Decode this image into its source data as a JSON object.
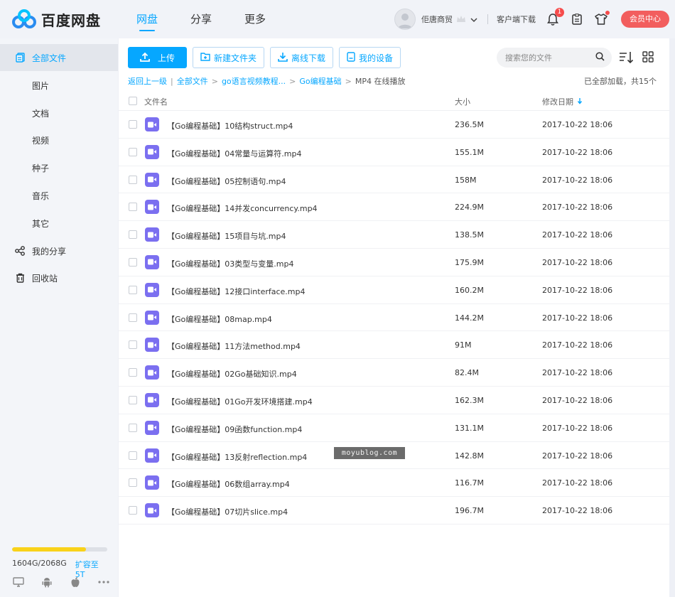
{
  "brand": {
    "name": "百度网盘"
  },
  "nav": [
    {
      "label": "网盘",
      "active": true
    },
    {
      "label": "分享",
      "active": false
    },
    {
      "label": "更多",
      "active": false
    }
  ],
  "user": {
    "name": "佢唐商贸"
  },
  "header": {
    "client_download": "客户端下载",
    "notification_count": "1",
    "vip_button": "会员中心",
    "colors": {
      "accent": "#06a7ff",
      "vip": "#f25e5e"
    },
    "icons": [
      "bell-icon",
      "clipboard-icon",
      "tshirt-icon"
    ]
  },
  "sidebar": {
    "items": [
      {
        "label": "全部文件",
        "icon": "files-icon",
        "active": true
      },
      {
        "label": "图片"
      },
      {
        "label": "文档"
      },
      {
        "label": "视频"
      },
      {
        "label": "种子"
      },
      {
        "label": "音乐"
      },
      {
        "label": "其它"
      },
      {
        "label": "我的分享",
        "icon": "share-icon"
      },
      {
        "label": "回收站",
        "icon": "trash-icon"
      }
    ],
    "quota": {
      "used": "1604G/2068G",
      "used_fraction": 0.776,
      "expand_label": "扩容至5T"
    },
    "platforms": [
      "desktop-icon",
      "android-icon",
      "apple-icon",
      "more-icon"
    ]
  },
  "toolbar": {
    "upload": "上传",
    "new_folder": "新建文件夹",
    "offline_download": "离线下载",
    "my_devices": "我的设备"
  },
  "search": {
    "placeholder": "搜索您的文件"
  },
  "breadcrumb": {
    "back": "返回上一级",
    "items": [
      "全部文件",
      "go语言视频教程...",
      "Go编程基础"
    ],
    "current": "MP4 在线播放"
  },
  "status": {
    "loaded": "已全部加载，共15个"
  },
  "table": {
    "headers": {
      "name": "文件名",
      "size": "大小",
      "date": "修改日期"
    },
    "rows": [
      {
        "name": "【Go编程基础】10结构struct.mp4",
        "size": "236.5M",
        "date": "2017-10-22 18:06"
      },
      {
        "name": "【Go编程基础】04常量与运算符.mp4",
        "size": "155.1M",
        "date": "2017-10-22 18:06"
      },
      {
        "name": "【Go编程基础】05控制语句.mp4",
        "size": "158M",
        "date": "2017-10-22 18:06"
      },
      {
        "name": "【Go编程基础】14并发concurrency.mp4",
        "size": "224.9M",
        "date": "2017-10-22 18:06"
      },
      {
        "name": "【Go编程基础】15项目与坑.mp4",
        "size": "138.5M",
        "date": "2017-10-22 18:06"
      },
      {
        "name": "【Go编程基础】03类型与变量.mp4",
        "size": "175.9M",
        "date": "2017-10-22 18:06"
      },
      {
        "name": "【Go编程基础】12接口interface.mp4",
        "size": "160.2M",
        "date": "2017-10-22 18:06"
      },
      {
        "name": "【Go编程基础】08map.mp4",
        "size": "144.2M",
        "date": "2017-10-22 18:06"
      },
      {
        "name": "【Go编程基础】11方法method.mp4",
        "size": "91M",
        "date": "2017-10-22 18:06"
      },
      {
        "name": "【Go编程基础】02Go基础知识.mp4",
        "size": "82.4M",
        "date": "2017-10-22 18:06"
      },
      {
        "name": "【Go编程基础】01Go开发环境搭建.mp4",
        "size": "162.3M",
        "date": "2017-10-22 18:06"
      },
      {
        "name": "【Go编程基础】09函数function.mp4",
        "size": "131.1M",
        "date": "2017-10-22 18:06"
      },
      {
        "name": "【Go编程基础】13反射reflection.mp4",
        "size": "142.8M",
        "date": "2017-10-22 18:06"
      },
      {
        "name": "【Go编程基础】06数组array.mp4",
        "size": "116.7M",
        "date": "2017-10-22 18:06"
      },
      {
        "name": "【Go编程基础】07切片slice.mp4",
        "size": "196.7M",
        "date": "2017-10-22 18:06"
      }
    ]
  },
  "watermark": {
    "text": "moyublog.com"
  }
}
